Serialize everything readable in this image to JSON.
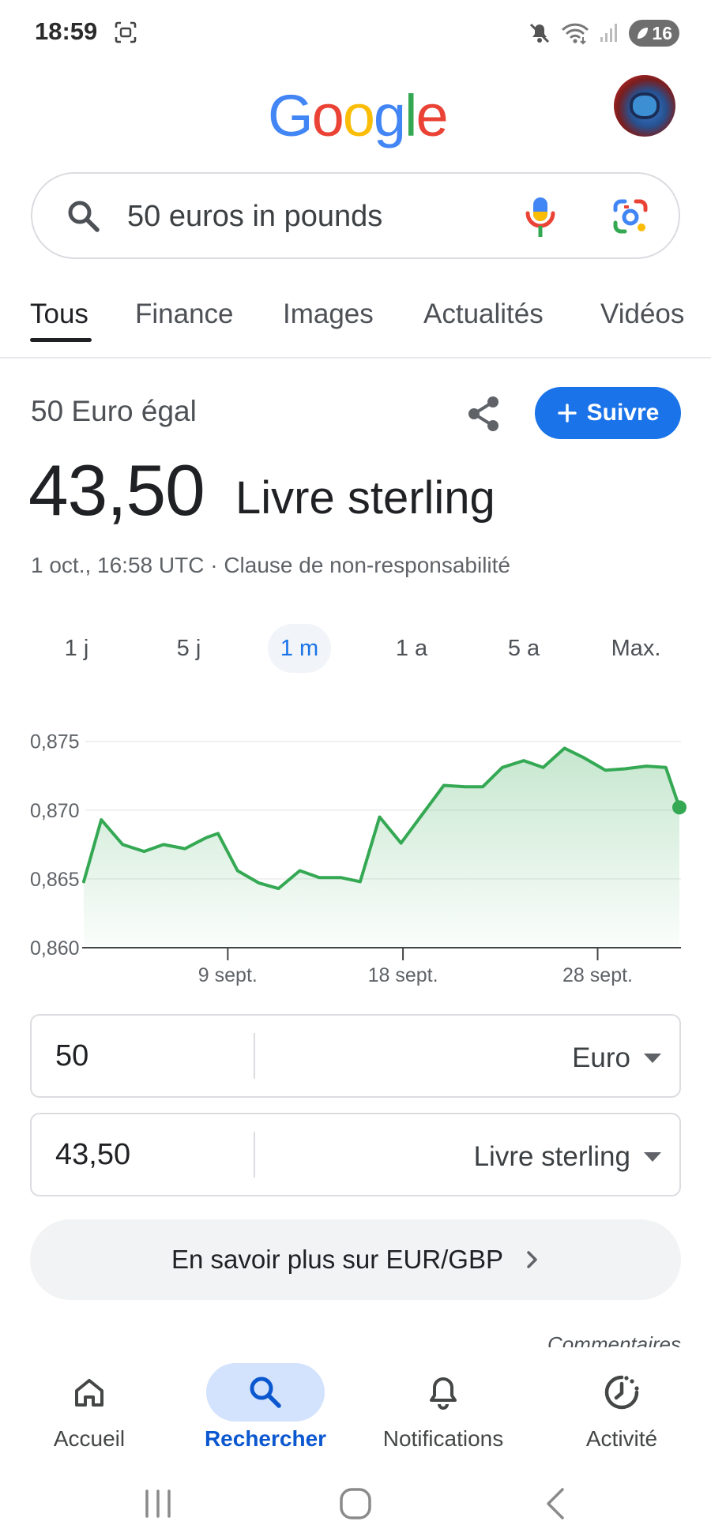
{
  "status_bar": {
    "time": "18:59",
    "battery": "16",
    "icons": [
      "screenshot-icon",
      "mute-icon",
      "wifi-icon",
      "signal-icon",
      "battery-icon"
    ]
  },
  "header": {
    "logo_text": "Google",
    "logo_colors": [
      "#4285F4",
      "#EA4335",
      "#FBBC05",
      "#4285F4",
      "#34A853",
      "#EA4335"
    ]
  },
  "search": {
    "query": "50 euros in pounds"
  },
  "tabs": [
    {
      "label": "Tous",
      "active": true
    },
    {
      "label": "Finance",
      "active": false
    },
    {
      "label": "Images",
      "active": false
    },
    {
      "label": "Actualités",
      "active": false
    },
    {
      "label": "Vidéos",
      "active": false
    }
  ],
  "result": {
    "equals_label": "50 Euro égal",
    "follow_label": "Suivre",
    "value": "43,50",
    "unit": "Livre sterling",
    "timestamp": "1 oct., 16:58 UTC · Clause de non-responsabilité"
  },
  "ranges": [
    {
      "label": "1 j",
      "active": false
    },
    {
      "label": "5 j",
      "active": false
    },
    {
      "label": "1 m",
      "active": true
    },
    {
      "label": "1 a",
      "active": false
    },
    {
      "label": "5 a",
      "active": false
    },
    {
      "label": "Max.",
      "active": false
    }
  ],
  "chart_data": {
    "type": "area",
    "line_color": "#34A853",
    "y_ticks": [
      "0,875",
      "0,870",
      "0,865",
      "0,860"
    ],
    "y_tick_values": [
      0.875,
      0.87,
      0.865,
      0.86
    ],
    "ylim": [
      0.86,
      0.8755
    ],
    "x_ticks": [
      {
        "label": "9 sept.",
        "day": 9
      },
      {
        "label": "18 sept.",
        "day": 18
      },
      {
        "label": "28 sept.",
        "day": 28
      }
    ],
    "xlim": [
      1.6,
      32.2
    ],
    "grid": true,
    "points": [
      {
        "x": 1.6,
        "y": 0.8648
      },
      {
        "x": 2.5,
        "y": 0.8693
      },
      {
        "x": 3.6,
        "y": 0.8675
      },
      {
        "x": 4.7,
        "y": 0.867
      },
      {
        "x": 5.7,
        "y": 0.8675
      },
      {
        "x": 6.8,
        "y": 0.8672
      },
      {
        "x": 7.9,
        "y": 0.868
      },
      {
        "x": 8.5,
        "y": 0.8683
      },
      {
        "x": 9.5,
        "y": 0.8656
      },
      {
        "x": 10.6,
        "y": 0.8647
      },
      {
        "x": 11.6,
        "y": 0.8643
      },
      {
        "x": 12.7,
        "y": 0.8656
      },
      {
        "x": 13.7,
        "y": 0.8651
      },
      {
        "x": 14.8,
        "y": 0.8651
      },
      {
        "x": 15.8,
        "y": 0.8648
      },
      {
        "x": 16.8,
        "y": 0.8695
      },
      {
        "x": 17.9,
        "y": 0.8676
      },
      {
        "x": 19.0,
        "y": 0.8697
      },
      {
        "x": 20.1,
        "y": 0.8718
      },
      {
        "x": 21.2,
        "y": 0.8717
      },
      {
        "x": 22.1,
        "y": 0.8717
      },
      {
        "x": 23.1,
        "y": 0.8731
      },
      {
        "x": 24.2,
        "y": 0.8736
      },
      {
        "x": 25.2,
        "y": 0.8731
      },
      {
        "x": 26.3,
        "y": 0.8745
      },
      {
        "x": 27.3,
        "y": 0.8738
      },
      {
        "x": 28.4,
        "y": 0.8729
      },
      {
        "x": 29.4,
        "y": 0.873
      },
      {
        "x": 30.5,
        "y": 0.8732
      },
      {
        "x": 31.5,
        "y": 0.8731
      },
      {
        "x": 32.2,
        "y": 0.8702
      }
    ]
  },
  "converter": {
    "from": {
      "value": "50",
      "unit": "Euro"
    },
    "to": {
      "value": "43,50",
      "unit": "Livre sterling"
    }
  },
  "learn_more": "En savoir plus sur EUR/GBP",
  "comments": "Commentaires",
  "bottom_nav": [
    {
      "label": "Accueil",
      "icon": "home-icon",
      "active": false
    },
    {
      "label": "Rechercher",
      "icon": "search-icon",
      "active": true
    },
    {
      "label": "Notifications",
      "icon": "bell-icon",
      "active": false
    },
    {
      "label": "Activité",
      "icon": "activity-icon",
      "active": false
    }
  ]
}
